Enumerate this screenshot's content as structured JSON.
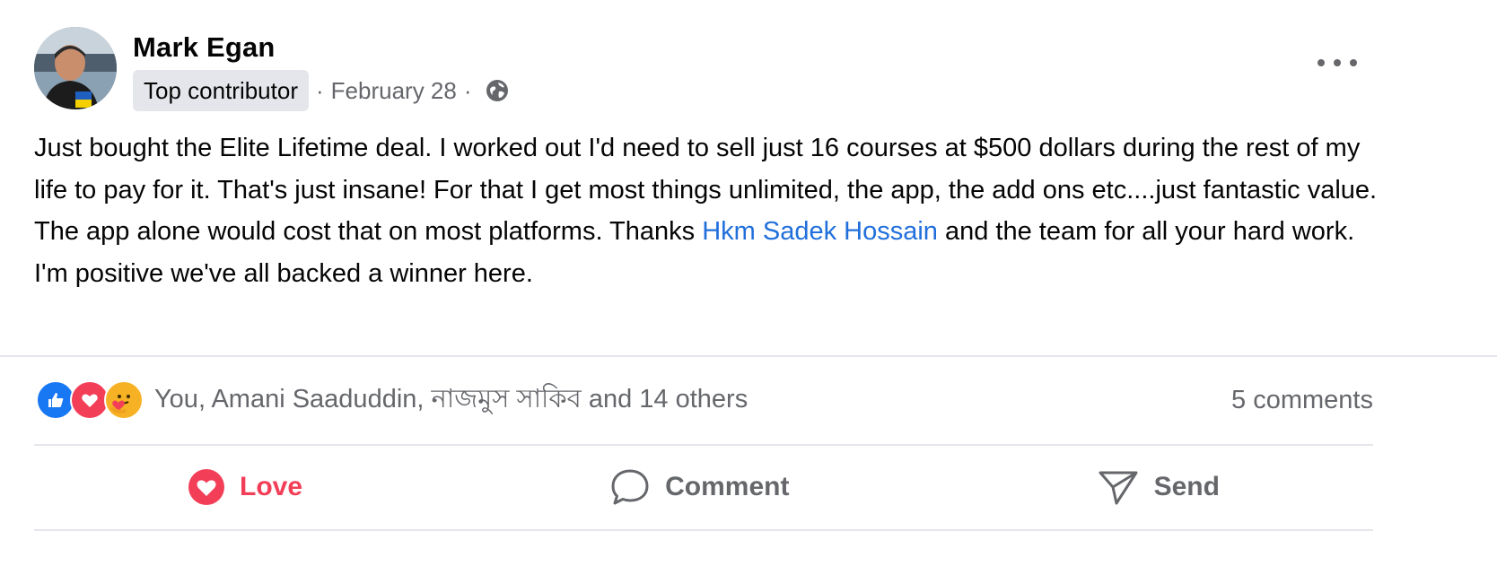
{
  "post": {
    "author": "Mark Egan",
    "badge": "Top contributor",
    "separator": "·",
    "date": "February 28",
    "privacy_icon": "globe-icon",
    "more_icon": "more-options-icon",
    "body": {
      "before_mention": "Just bought the Elite Lifetime deal. I worked out I'd need to sell just 16 courses at $500 dollars during the rest of my life to pay for it. That's just insane! For that I get most things unlimited, the app, the add ons  etc....just fantastic value. The app alone would cost that on most platforms. Thanks ",
      "mention": "Hkm Sadek Hossain",
      "after_mention": " and the team for all your hard work. I'm positive we've all backed a winner here."
    }
  },
  "stats": {
    "reaction_icons": [
      "like-icon",
      "love-icon",
      "care-icon"
    ],
    "reactors": "You, Amani Saaduddin, নাজমুস সাকিব and 14 others",
    "comments": "5 comments"
  },
  "actions": {
    "love": {
      "label": "Love",
      "icon": "heart-icon"
    },
    "comment": {
      "label": "Comment",
      "icon": "comment-bubble-icon"
    },
    "send": {
      "label": "Send",
      "icon": "send-icon"
    }
  },
  "colors": {
    "mention": "#216fdb",
    "love": "#f33e58",
    "like": "#1877f2",
    "secondary_text": "#65676b",
    "badge_bg": "#e4e6eb"
  }
}
